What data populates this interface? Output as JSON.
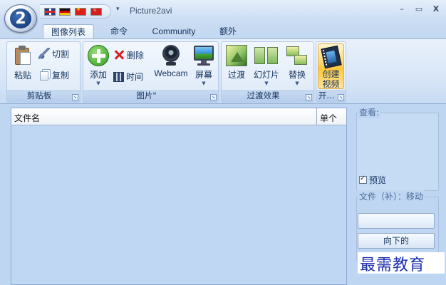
{
  "titlebar": {
    "app_logo_text": "2",
    "title": "Picture2avi",
    "qat_more": "▾",
    "flags": [
      "uk-flag-icon",
      "de-flag-icon",
      "cn-flag-icon",
      "tr-flag-icon"
    ],
    "minimize": "–",
    "maximize": "▭",
    "close": "X"
  },
  "tabs": [
    {
      "label": "图像列表",
      "active": true
    },
    {
      "label": "命令",
      "active": false
    },
    {
      "label": "Community",
      "active": false
    },
    {
      "label": "额外",
      "active": false
    }
  ],
  "ribbon": {
    "clipboard": {
      "label": "剪贴板",
      "paste": "粘贴",
      "cut": "切割",
      "copy": "复制"
    },
    "pictures": {
      "label": "图片\"",
      "add": "添加",
      "delete": "删除",
      "time": "时间",
      "webcam": "Webcam",
      "screen": "屏幕"
    },
    "transitions": {
      "label": "过渡效果",
      "transition": "过渡",
      "slideshow": "幻灯片",
      "replace": "替换"
    },
    "create": {
      "label": "开...",
      "line1": "创建",
      "line2": "视频"
    }
  },
  "file_list": {
    "columns": [
      "文件名",
      "单个"
    ]
  },
  "side_panel": {
    "view_label": "查看:",
    "preview_label": "预览",
    "preview_checked": true,
    "file_label": "文件（补）：移动",
    "down_button": "向下的"
  },
  "watermark": "最需教育",
  "colors": {
    "body_bg": "#bfd6f2",
    "ribbon_text": "#15345e",
    "create_highlight": "#ffd668",
    "watermark": "#1b2fae"
  }
}
